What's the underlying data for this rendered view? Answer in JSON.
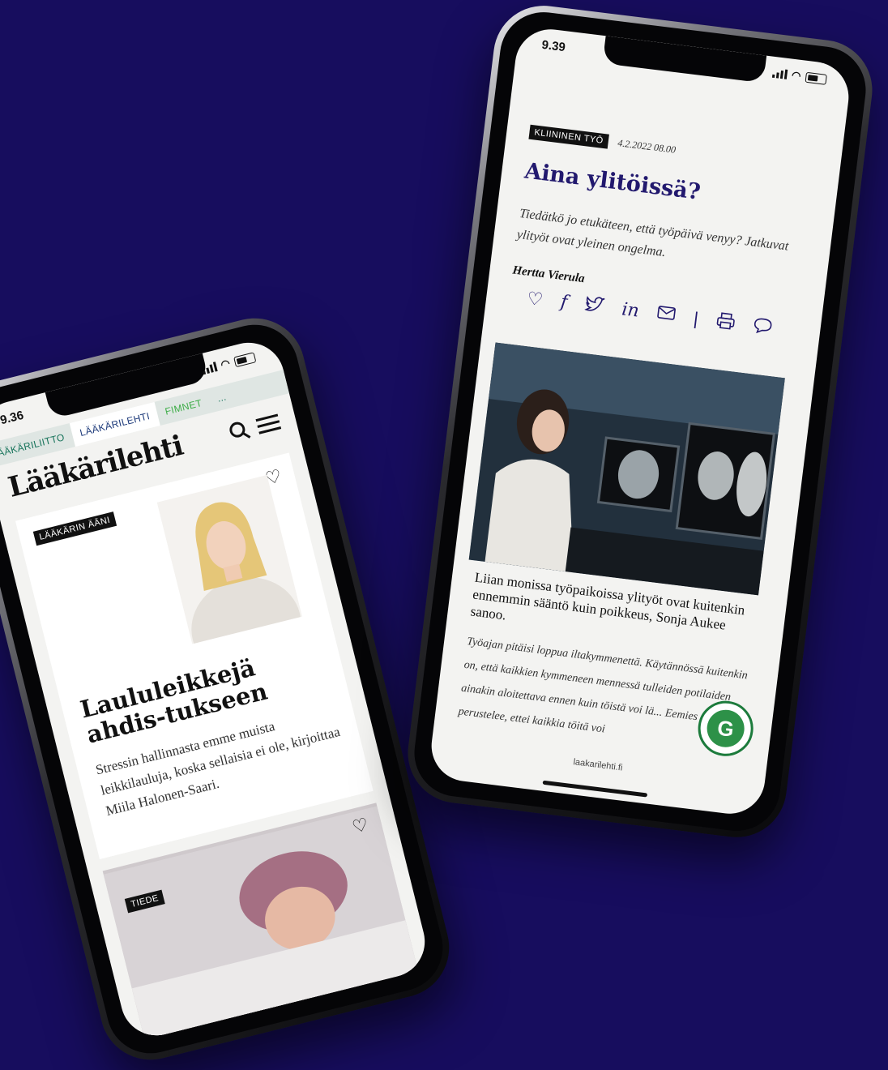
{
  "left_phone": {
    "time": "9.36",
    "tabs": [
      "LÄÄKÄRILIITTO",
      "LÄÄKÄRILEHTI",
      "FIMNET",
      "..."
    ],
    "logo": "Lääkärilehti",
    "card1": {
      "tag": "LÄÄKÄRIN ÄÄNI",
      "headline": "Laululeikkejä ahdis-tukseen",
      "lead": "Stressin hallinnasta emme muista leikkilauluja, koska sellaisia ei ole, kirjoittaa Miila Halonen-Saari."
    },
    "card2": {
      "tag": "TIEDE"
    }
  },
  "right_phone": {
    "time": "9.39",
    "tag": "KLIININEN TYÖ",
    "date": "4.2.2022 08.00",
    "title": "Aina ylitöissä?",
    "lead": "Tiedätkö jo etukäteen, että työpäivä venyy? Jatkuvat ylityöt ovat yleinen ongelma.",
    "author": "Hertta Vierula",
    "caption": "Liian monissa työpaikoissa ylityöt ovat kuitenkin ennemmin sääntö kuin poikkeus, Sonja Aukee sanoo.",
    "body": "Työajan pitäisi loppua iltakymmenettä. Käytännössä kuitenkin on, että kaikkien kymmeneen mennessä tulleiden potilaiden ainakin aloitettava ennen kuin töistä voi lä... Eemies perustelee, ettei kaikkia töitä voi",
    "url": "laakarilehti.fi"
  },
  "colors": {
    "background": "#170d5e",
    "accent_green": "#1c7b3c",
    "title_navy": "#22196e"
  }
}
